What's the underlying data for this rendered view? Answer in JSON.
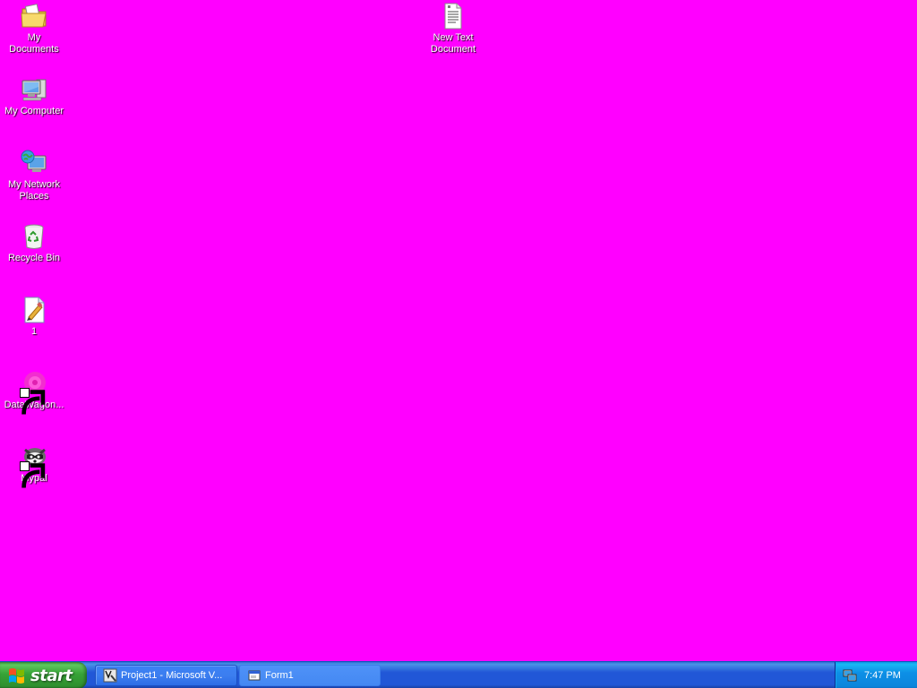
{
  "desktop": {
    "background_color": "#ff00ff",
    "icons": [
      {
        "label": "My Documents",
        "icon": "folder-documents-icon"
      },
      {
        "label": "My Computer",
        "icon": "computer-icon"
      },
      {
        "label": "My Network Places",
        "icon": "network-places-icon"
      },
      {
        "label": "Recycle Bin",
        "icon": "recycle-bin-icon"
      },
      {
        "label": "1",
        "icon": "image-file-icon"
      },
      {
        "label": "DataWagon...",
        "icon": "datawagon-shortcut-icon"
      },
      {
        "label": "Mypal",
        "icon": "mypal-shortcut-icon"
      },
      {
        "label": "New Text Document",
        "icon": "text-document-icon"
      }
    ]
  },
  "taskbar": {
    "start_label": "start",
    "tasks": [
      {
        "label": "Project1 - Microsoft V...",
        "icon": "visual-basic-icon",
        "state": "inactive"
      },
      {
        "label": "Form1",
        "icon": "form-window-icon",
        "state": "active"
      }
    ],
    "tray": {
      "icon": "network-tray-icon",
      "clock": "7:47 PM"
    }
  },
  "colors": {
    "taskbar_blue": "#2157d7",
    "start_green": "#37a337",
    "tray_blue": "#0d8fe6"
  }
}
